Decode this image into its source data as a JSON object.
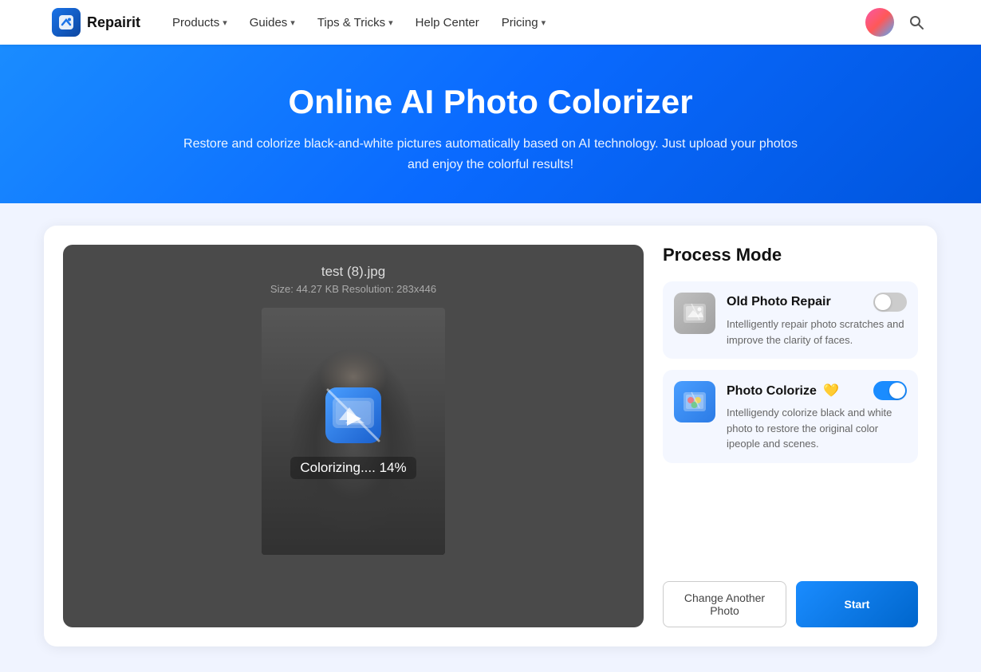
{
  "nav": {
    "logo_text": "Repairit",
    "items": [
      {
        "label": "Products",
        "has_dropdown": true
      },
      {
        "label": "Guides",
        "has_dropdown": true
      },
      {
        "label": "Tips & Tricks",
        "has_dropdown": true
      },
      {
        "label": "Help Center",
        "has_dropdown": false
      },
      {
        "label": "Pricing",
        "has_dropdown": true
      }
    ]
  },
  "hero": {
    "title": "Online AI Photo Colorizer",
    "description": "Restore and colorize black-and-white pictures automatically based on AI technology. Just upload your photos and enjoy the colorful results!"
  },
  "tool": {
    "file_name": "test (8).jpg",
    "file_meta": "Size: 44.27 KB  Resolution: 283x446",
    "processing_label": "Colorizing.... 14%",
    "process_mode_title": "Process Mode",
    "modes": [
      {
        "name": "Old Photo Repair",
        "badge": "",
        "description": "Intelligently repair photo scratches and improve the clarity of faces.",
        "enabled": false,
        "icon": "🖼️"
      },
      {
        "name": "Photo Colorize",
        "badge": "💛",
        "description": "Intelligendy colorize black and white photo to restore the original color ipeople and scenes.",
        "enabled": true,
        "icon": "🎨"
      }
    ],
    "btn_change": "Change Another Photo",
    "btn_start": "Start"
  }
}
